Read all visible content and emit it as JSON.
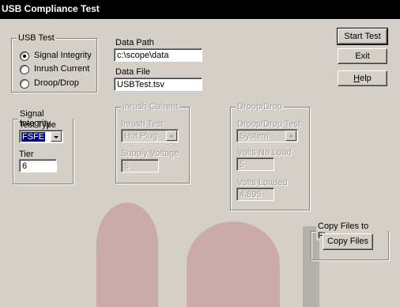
{
  "window": {
    "title": "USB Compliance Test"
  },
  "usb_test": {
    "legend": "USB Test",
    "options": [
      {
        "label": "Signal Integrity",
        "selected": true
      },
      {
        "label": "Inrush Current",
        "selected": false
      },
      {
        "label": "Droop/Drop",
        "selected": false
      }
    ]
  },
  "data_path": {
    "label": "Data Path",
    "value": "c:\\scope\\data"
  },
  "data_file": {
    "label": "Data File",
    "value": "USBTest.tsv"
  },
  "buttons": {
    "start": "Start Test",
    "exit": "Exit",
    "help_mnemonic": "H",
    "help_rest": "elp"
  },
  "signal_integrity": {
    "legend": "Signal Integrity",
    "test_type_label": "Test Type",
    "test_type_value": "FSFE",
    "tier_label": "Tier",
    "tier_value": "6"
  },
  "inrush_current": {
    "legend": "Inrush Current",
    "test_label": "Inrush Test",
    "test_value": "Hot Plug",
    "supply_label": "Supply Voltage",
    "supply_value": "5"
  },
  "droop_drop": {
    "legend": "Droop/Drop",
    "test_label": "Droop/Drop Test",
    "test_value": "System",
    "no_load_label": "Volts No Load",
    "no_load_value": "5",
    "loaded_label": "Volts Loaded",
    "loaded_value": "4.895"
  },
  "copy_files": {
    "legend": "Copy Files to Floppy",
    "button": "Copy Files"
  },
  "colors": {
    "face": "#d4d0c8",
    "titlebar": "#000000",
    "selection": "#000080",
    "watermark": "#c8a4a4"
  }
}
